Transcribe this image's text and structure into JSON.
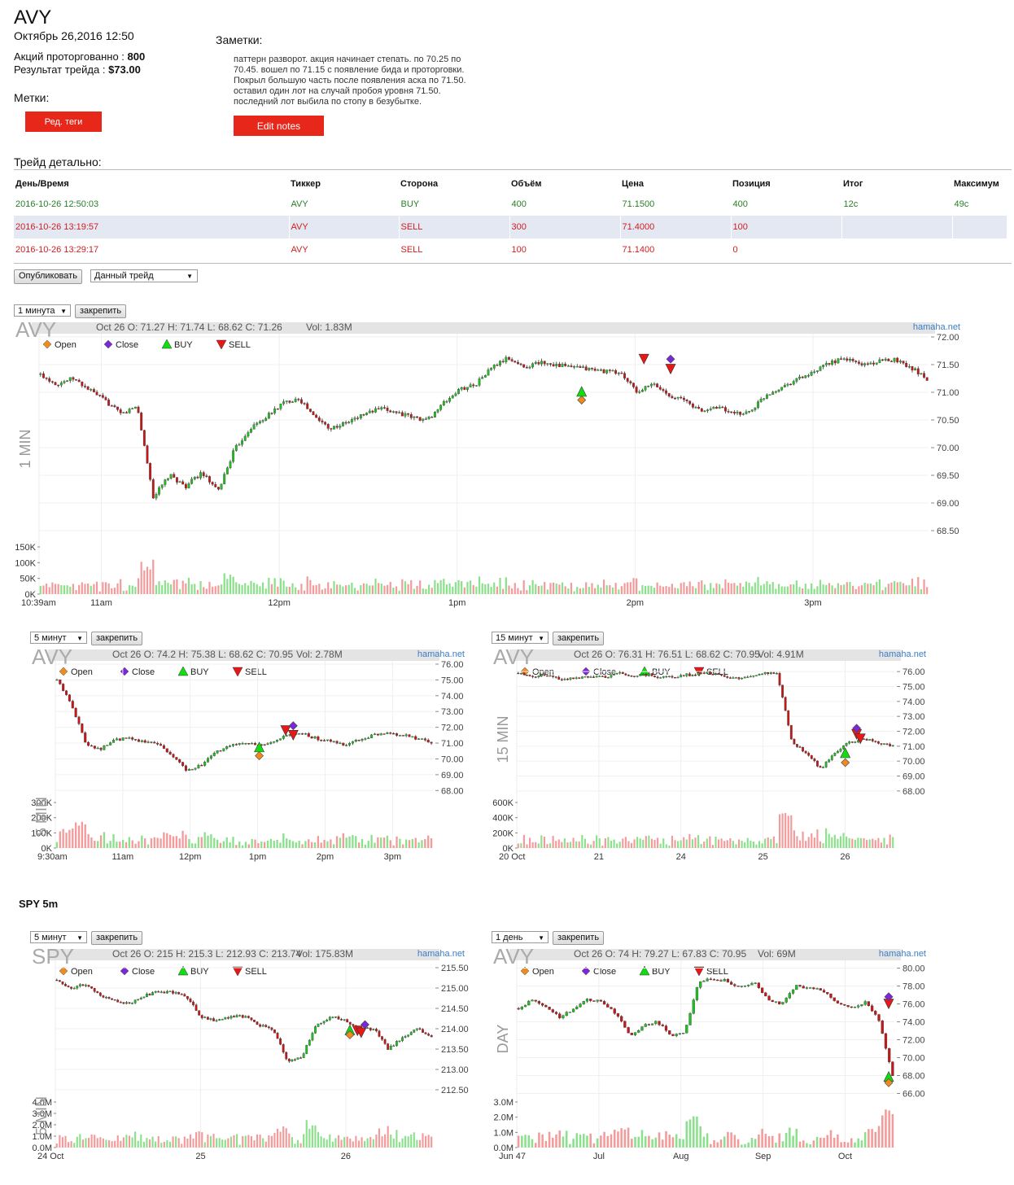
{
  "header": {
    "ticker": "AVY",
    "date": "Октябрь 26,2016 12:50",
    "shares_label": "Акций проторгованно :",
    "shares_value": "800",
    "result_label": "Результат трейда :",
    "result_value": "$73.00",
    "tags_label": "Метки:",
    "edit_tags_button": "Ред. теги",
    "notes_label": "Заметки:",
    "notes_lines": [
      "паттерн разворот. акция начинает степать. по 70.25 по",
      "70.45. вошел по 71.15 с появление бида и проторговки.",
      "Покрыл большую часть после появления аска по 71.50.",
      "оставил один лот на случай пробоя уровня 71.50.",
      "последний лот выбила по стопу в безубытке."
    ],
    "edit_notes_button": "Edit notes"
  },
  "details": {
    "title": "Трейд детально:",
    "columns": [
      "День/Время",
      "Тиккер",
      "Сторона",
      "Объём",
      "Цена",
      "Позиция",
      "Итог",
      "Максимум"
    ],
    "rows": [
      {
        "datetime": "2016-10-26 12:50:03",
        "ticker": "AVY",
        "side": "BUY",
        "volume": "400",
        "price": "71.1500",
        "position": "400",
        "result": "12c",
        "max": "49c"
      },
      {
        "datetime": "2016-10-26 13:19:57",
        "ticker": "AVY",
        "side": "SELL",
        "volume": "300",
        "price": "71.4000",
        "position": "100",
        "result": "",
        "max": ""
      },
      {
        "datetime": "2016-10-26 13:29:17",
        "ticker": "AVY",
        "side": "SELL",
        "volume": "100",
        "price": "71.1400",
        "position": "0",
        "result": "",
        "max": ""
      }
    ]
  },
  "controls": {
    "publish_button": "Опубликовать",
    "scope_select": "Данный трейд"
  },
  "legend": {
    "open": "Open",
    "close": "Close",
    "buy": "BUY",
    "sell": "SELL"
  },
  "colors": {
    "up": "#22bb22",
    "down": "#c41818",
    "buy": "#11dd11",
    "sell": "#e81818",
    "open": "#f08a1c",
    "close": "#7a28d8",
    "accent": "#e8271b"
  },
  "spy_label": "SPY 5m",
  "chart_data": [
    {
      "type": "candlestick",
      "panel": "avy_1min",
      "interval_select": "1 минута",
      "pin_button": "закрепить",
      "watermark": "AVY",
      "side_label": "1 MIN",
      "ohlc": "Oct 26 O: 71.27 H: 71.74 L: 68.62 C: 71.26",
      "vol": "Vol: 1.83M",
      "brand": "hamaha.net",
      "ylim": [
        68.25,
        72.0
      ],
      "yticks": [
        "72.00",
        "71.50",
        "71.00",
        "70.50",
        "70.00",
        "69.50",
        "69.00",
        "68.50"
      ],
      "vol_ticks": [
        "150K",
        "100K",
        "50K",
        "0K"
      ],
      "vol_max": 150000,
      "x_ticks": [
        "10:39am",
        "11am",
        "12pm",
        "1pm",
        "2pm",
        "3pm"
      ],
      "price_path": [
        71.32,
        71.15,
        71.25,
        71.05,
        70.85,
        70.6,
        70.75,
        69.1,
        69.5,
        69.3,
        69.55,
        69.2,
        69.95,
        70.35,
        70.55,
        70.8,
        70.9,
        70.55,
        70.35,
        70.45,
        70.6,
        70.7,
        70.65,
        70.55,
        70.5,
        70.8,
        71.05,
        71.15,
        71.45,
        71.62,
        71.45,
        71.55,
        71.5,
        71.45,
        71.42,
        71.38,
        71.35,
        71.0,
        71.15,
        70.95,
        70.85,
        70.65,
        70.75,
        70.6,
        70.65,
        70.95,
        71.1,
        71.25,
        71.35,
        71.55,
        71.6,
        71.5,
        71.55,
        71.6,
        71.45,
        71.25
      ],
      "markers": [
        {
          "kind": "buy",
          "t": 0.61,
          "price": 71.0
        },
        {
          "kind": "open",
          "t": 0.61,
          "price": 70.86
        },
        {
          "kind": "sell",
          "t": 0.68,
          "price": 71.6
        },
        {
          "kind": "sell",
          "t": 0.71,
          "price": 71.42
        },
        {
          "kind": "close",
          "t": 0.71,
          "price": 71.6
        }
      ]
    },
    {
      "type": "candlestick",
      "panel": "avy_5min",
      "interval_select": "5 минут",
      "pin_button": "закрепить",
      "watermark": "AVY",
      "side_label": "5 MIN",
      "ohlc": "Oct 26 O: 74.2 H: 75.38 L: 68.62 C: 70.95",
      "vol": "Vol: 2.78M",
      "brand": "hamaha.net",
      "ylim": [
        67.5,
        76.0
      ],
      "yticks": [
        "76.00",
        "75.00",
        "74.00",
        "73.00",
        "72.00",
        "71.00",
        "70.00",
        "69.00",
        "68.00"
      ],
      "vol_ticks": [
        "300K",
        "200K",
        "100K",
        "0K"
      ],
      "vol_max": 300000,
      "x_ticks": [
        "9:30am",
        "11am",
        "12pm",
        "1pm",
        "2pm",
        "3pm"
      ],
      "price_path": [
        75.0,
        73.5,
        71.0,
        70.6,
        71.2,
        71.3,
        71.1,
        71.0,
        70.2,
        69.3,
        69.6,
        70.4,
        70.8,
        71.1,
        70.8,
        71.0,
        71.5,
        71.6,
        71.3,
        71.1,
        70.9,
        71.2,
        71.5,
        71.6,
        71.5,
        71.3,
        71.0
      ],
      "markers": [
        {
          "kind": "buy",
          "t": 0.54,
          "price": 70.7
        },
        {
          "kind": "open",
          "t": 0.54,
          "price": 70.2
        },
        {
          "kind": "sell",
          "t": 0.61,
          "price": 71.8
        },
        {
          "kind": "sell",
          "t": 0.63,
          "price": 71.5
        },
        {
          "kind": "close",
          "t": 0.63,
          "price": 72.1
        }
      ]
    },
    {
      "type": "candlestick",
      "panel": "avy_15min",
      "interval_select": "15 минут",
      "pin_button": "закрепить",
      "watermark": "AVY",
      "side_label": "15 MIN",
      "ohlc": "Oct 26 O: 76.31 H: 76.51 L: 68.62 C: 70.95",
      "vol": "Vol: 4.91M",
      "brand": "hamaha.net",
      "ylim": [
        67.5,
        76.5
      ],
      "yticks": [
        "76.00",
        "75.00",
        "74.00",
        "73.00",
        "72.00",
        "71.00",
        "70.00",
        "69.00",
        "68.00"
      ],
      "vol_ticks": [
        "600K",
        "400K",
        "200K",
        "0K"
      ],
      "vol_max": 600000,
      "x_ticks": [
        "20 Oct",
        "21",
        "24",
        "25",
        "26"
      ],
      "price_path": [
        75.9,
        75.7,
        75.8,
        75.5,
        75.6,
        75.7,
        75.6,
        75.9,
        75.7,
        75.8,
        75.6,
        75.7,
        75.8,
        75.9,
        75.8,
        75.5,
        75.7,
        75.9,
        75.8,
        71.3,
        70.5,
        69.5,
        70.6,
        71.3,
        71.5,
        71.2,
        71.0
      ],
      "markers": [
        {
          "kind": "buy",
          "t": 0.87,
          "price": 70.5
        },
        {
          "kind": "open",
          "t": 0.87,
          "price": 69.9
        },
        {
          "kind": "sell",
          "t": 0.9,
          "price": 71.8
        },
        {
          "kind": "sell",
          "t": 0.91,
          "price": 71.5
        },
        {
          "kind": "close",
          "t": 0.9,
          "price": 72.2
        }
      ]
    },
    {
      "type": "candlestick",
      "panel": "spy_5min",
      "interval_select": "5 минут",
      "pin_button": "закрепить",
      "watermark": "SPY",
      "side_label": "5 MIN",
      "ohlc": "Oct 26 O: 215 H: 215.3 L: 212.93 C: 213.74",
      "vol": "Vol: 175.83M",
      "brand": "hamaha.net",
      "ylim": [
        212.3,
        215.6
      ],
      "yticks": [
        "215.50",
        "215.00",
        "214.50",
        "214.00",
        "213.50",
        "213.00",
        "212.50"
      ],
      "vol_ticks": [
        "4.0M",
        "3.0M",
        "2.0M",
        "1.0M",
        "0.0M"
      ],
      "vol_max": 4000000,
      "x_ticks": [
        "24 Oct",
        "25",
        "26"
      ],
      "price_path": [
        215.2,
        215.0,
        215.1,
        214.8,
        214.7,
        214.6,
        214.8,
        214.9,
        214.9,
        214.8,
        214.3,
        214.2,
        214.3,
        214.3,
        214.1,
        214.0,
        213.2,
        213.3,
        214.1,
        214.3,
        214.2,
        214.0,
        214.0,
        213.5,
        213.8,
        214.0,
        213.8
      ],
      "markers": [
        {
          "kind": "buy",
          "t": 0.78,
          "price": 213.95
        },
        {
          "kind": "open",
          "t": 0.78,
          "price": 213.85
        },
        {
          "kind": "sell",
          "t": 0.8,
          "price": 213.95
        },
        {
          "kind": "sell",
          "t": 0.81,
          "price": 213.9
        },
        {
          "kind": "close",
          "t": 0.82,
          "price": 214.1
        }
      ]
    },
    {
      "type": "candlestick",
      "panel": "avy_day",
      "interval_select": "1 день",
      "pin_button": "закрепить",
      "watermark": "AVY",
      "side_label": "DAY",
      "ohlc": "Oct 26 O: 74 H: 79.27 L: 67.83 C: 70.95",
      "vol": "Vol: 69M",
      "brand": "hamaha.net",
      "ylim": [
        65.5,
        80.5
      ],
      "yticks": [
        "80.00",
        "78.00",
        "76.00",
        "74.00",
        "72.00",
        "70.00",
        "68.00",
        "66.00"
      ],
      "vol_ticks": [
        "3.0M",
        "2.0M",
        "1.0M",
        "0.0M"
      ],
      "vol_max": 3000000,
      "x_ticks": [
        "Jun 47",
        "Jul",
        "Aug",
        "Sep",
        "Oct"
      ],
      "price_path": [
        75.5,
        76.5,
        75.8,
        74.5,
        75.5,
        76.5,
        76.2,
        75.0,
        72.5,
        73.5,
        74.0,
        72.5,
        72.8,
        78.5,
        78.8,
        78.6,
        77.8,
        78.4,
        76.5,
        76.0,
        78.0,
        77.8,
        77.5,
        76.0,
        75.5,
        76.2,
        74.2,
        68.0
      ],
      "markers": [
        {
          "kind": "buy",
          "t": 0.985,
          "price": 67.8
        },
        {
          "kind": "open",
          "t": 0.985,
          "price": 67.2
        },
        {
          "kind": "sell",
          "t": 0.985,
          "price": 76.0
        },
        {
          "kind": "close",
          "t": 0.985,
          "price": 76.8
        }
      ]
    }
  ]
}
